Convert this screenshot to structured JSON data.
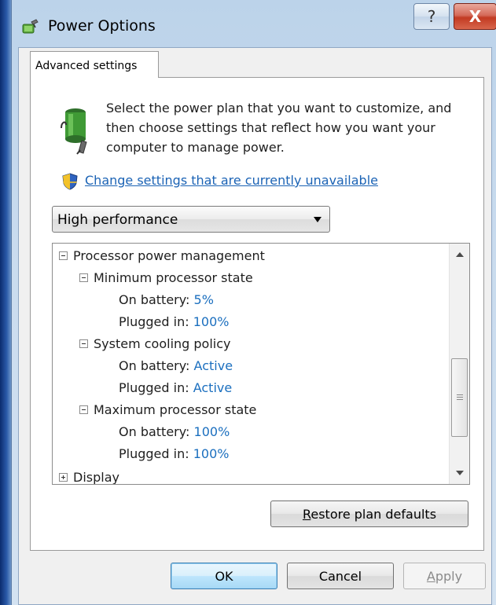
{
  "window": {
    "title": "Power Options",
    "help_glyph": "?",
    "close_glyph": "X"
  },
  "tab": {
    "label": "Advanced settings"
  },
  "intro": {
    "text": "Select the power plan that you want to customize, and then choose settings that reflect how you want your computer to manage power."
  },
  "change_settings_link": "Change settings that are currently unavailable",
  "plan_select": {
    "value": "High performance"
  },
  "tree": {
    "processor_power_management": "Processor power management",
    "min_state": {
      "label": "Minimum processor state",
      "on_battery_label": "On battery:",
      "on_battery_value": "5%",
      "plugged_in_label": "Plugged in:",
      "plugged_in_value": "100%"
    },
    "cooling": {
      "label": "System cooling policy",
      "on_battery_label": "On battery:",
      "on_battery_value": "Active",
      "plugged_in_label": "Plugged in:",
      "plugged_in_value": "Active"
    },
    "max_state": {
      "label": "Maximum processor state",
      "on_battery_label": "On battery:",
      "on_battery_value": "100%",
      "plugged_in_label": "Plugged in:",
      "plugged_in_value": "100%"
    },
    "display": "Display"
  },
  "buttons": {
    "restore_first": "R",
    "restore_rest": "estore plan defaults",
    "ok": "OK",
    "cancel": "Cancel",
    "apply_first": "A",
    "apply_rest": "pply"
  },
  "colors": {
    "link": "#1b63b5",
    "value": "#1b6fbf",
    "close_button": "#c23a22"
  },
  "icons": {
    "title": "power-options-icon",
    "intro": "battery-plug-icon",
    "uac": "uac-shield-icon"
  }
}
